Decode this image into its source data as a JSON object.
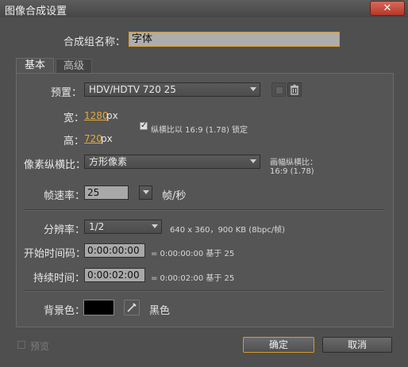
{
  "window": {
    "title": "图像合成设置",
    "close_glyph": "✕"
  },
  "name_label": "合成组名称：",
  "comp_name": "字体",
  "tabs": [
    {
      "label": "基本"
    },
    {
      "label": "高级"
    }
  ],
  "preset": {
    "label": "预置：",
    "value": "HDV/HDTV 720 25"
  },
  "width": {
    "label": "宽：",
    "value": "1280",
    "unit": "px"
  },
  "height": {
    "label": "高：",
    "value": "720",
    "unit": "px"
  },
  "lock_aspect": {
    "checked": true,
    "check_glyph": "✓",
    "label": "纵横比以 16:9 (1.78) 锁定"
  },
  "pixel_aspect": {
    "label": "像素纵横比：",
    "value": "方形像素"
  },
  "frame_aspect": {
    "label": "画幅纵横比：",
    "value": "16:9 (1.78)"
  },
  "frame_rate": {
    "label": "帧速率：",
    "value": "25",
    "unit": "帧/秒"
  },
  "resolution": {
    "label": "分辨率：",
    "value": "1/2",
    "info": "640 x 360，900 KB (8bpc/帧)"
  },
  "start_timecode": {
    "label": "开始时间码：",
    "value": "0:00:00:00",
    "info": "= 0:00:00:00  基于 25"
  },
  "duration": {
    "label": "持续时间：",
    "value": "0:00:02:00",
    "info": "= 0:00:02:00  基于 25"
  },
  "background": {
    "label": "背景色：",
    "color": "#000000",
    "color_name": "黑色"
  },
  "preview": {
    "label": "预览"
  },
  "buttons": {
    "ok": "确定",
    "cancel": "取消"
  },
  "colors": {
    "accent": "#d89a2c",
    "link": "#e3a93a",
    "panel": "#555555"
  }
}
